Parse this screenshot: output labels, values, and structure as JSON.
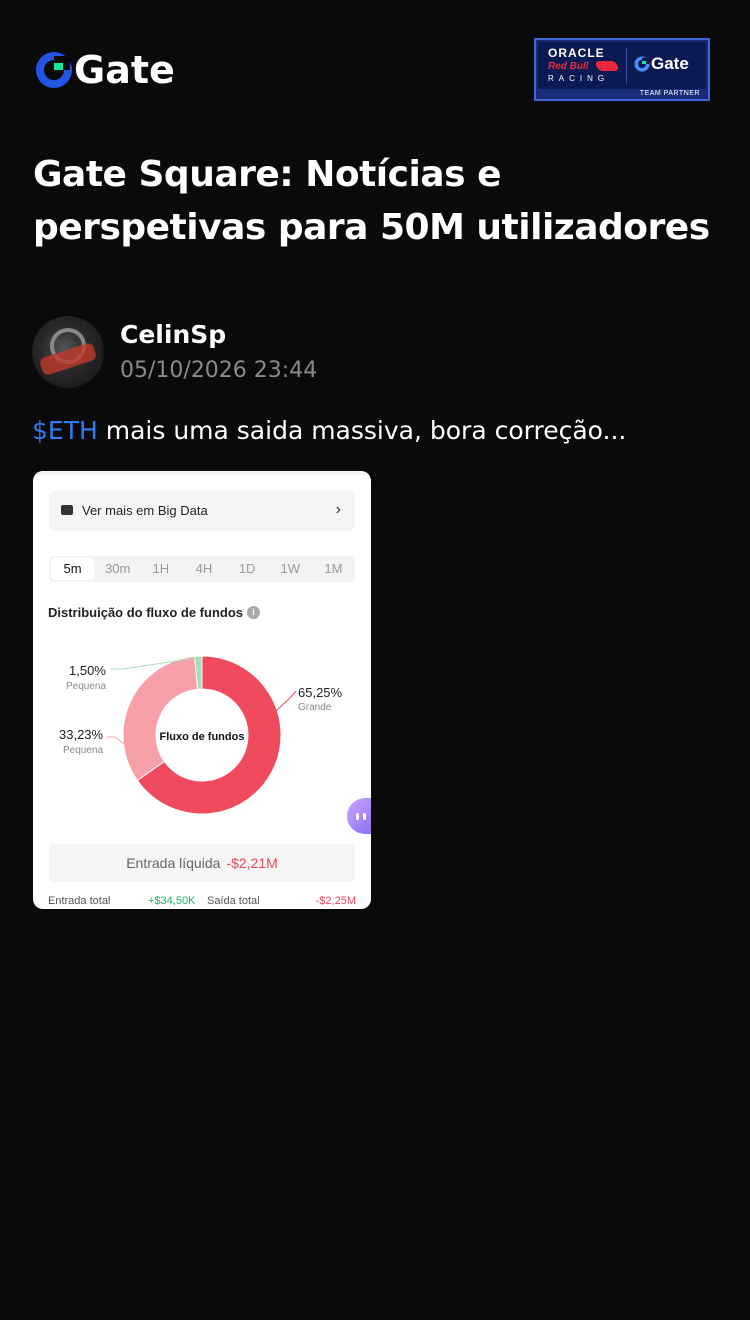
{
  "header": {
    "logo_text": "Gate",
    "partner": {
      "line1": "ORACLE",
      "line2": "Red Bull",
      "line3": "RACING",
      "gate": "Gate",
      "team_partner": "TEAM PARTNER"
    }
  },
  "title": "Gate Square: Notícias e perspetivas para 50M utilizadores",
  "author": {
    "name": "CelinSp",
    "time": "05/10/2026 23:44"
  },
  "post": {
    "tag": "$ETH",
    "text": " mais uma saida massiva, bora correção..."
  },
  "screenshot": {
    "big_data_label": "Ver mais em Big Data",
    "periods": [
      "5m",
      "30m",
      "1H",
      "4H",
      "1D",
      "1W",
      "1M"
    ],
    "active_period": "5m",
    "dist_title": "Distribuição do fluxo de fundos",
    "donut_center": "Fluxo de fundos",
    "slices": [
      {
        "label": "Grande",
        "value_text": "65,25%",
        "value": 65.25,
        "color": "#f04a5e"
      },
      {
        "label": "Pequena",
        "value_text": "33,23%",
        "value": 33.23,
        "color": "#f8a0a8"
      },
      {
        "label": "Pequena",
        "value_text": "1,50%",
        "value": 1.5,
        "color": "#a8dcbc"
      }
    ],
    "entrada_label": "Entrada líquida",
    "entrada_value": "-$2,21M",
    "entrada_total_label": "Entrada total",
    "entrada_total_value": "+$34,50K",
    "saida_total_label": "Saída total",
    "saida_total_value": "-$2,25M"
  },
  "colors": {
    "background": "#0a0a0a",
    "tag": "#2f7cf6",
    "brand_blue": "#2354e6",
    "brand_green": "#17e6a1",
    "negative": "#e8475a",
    "positive": "#20b26c"
  }
}
